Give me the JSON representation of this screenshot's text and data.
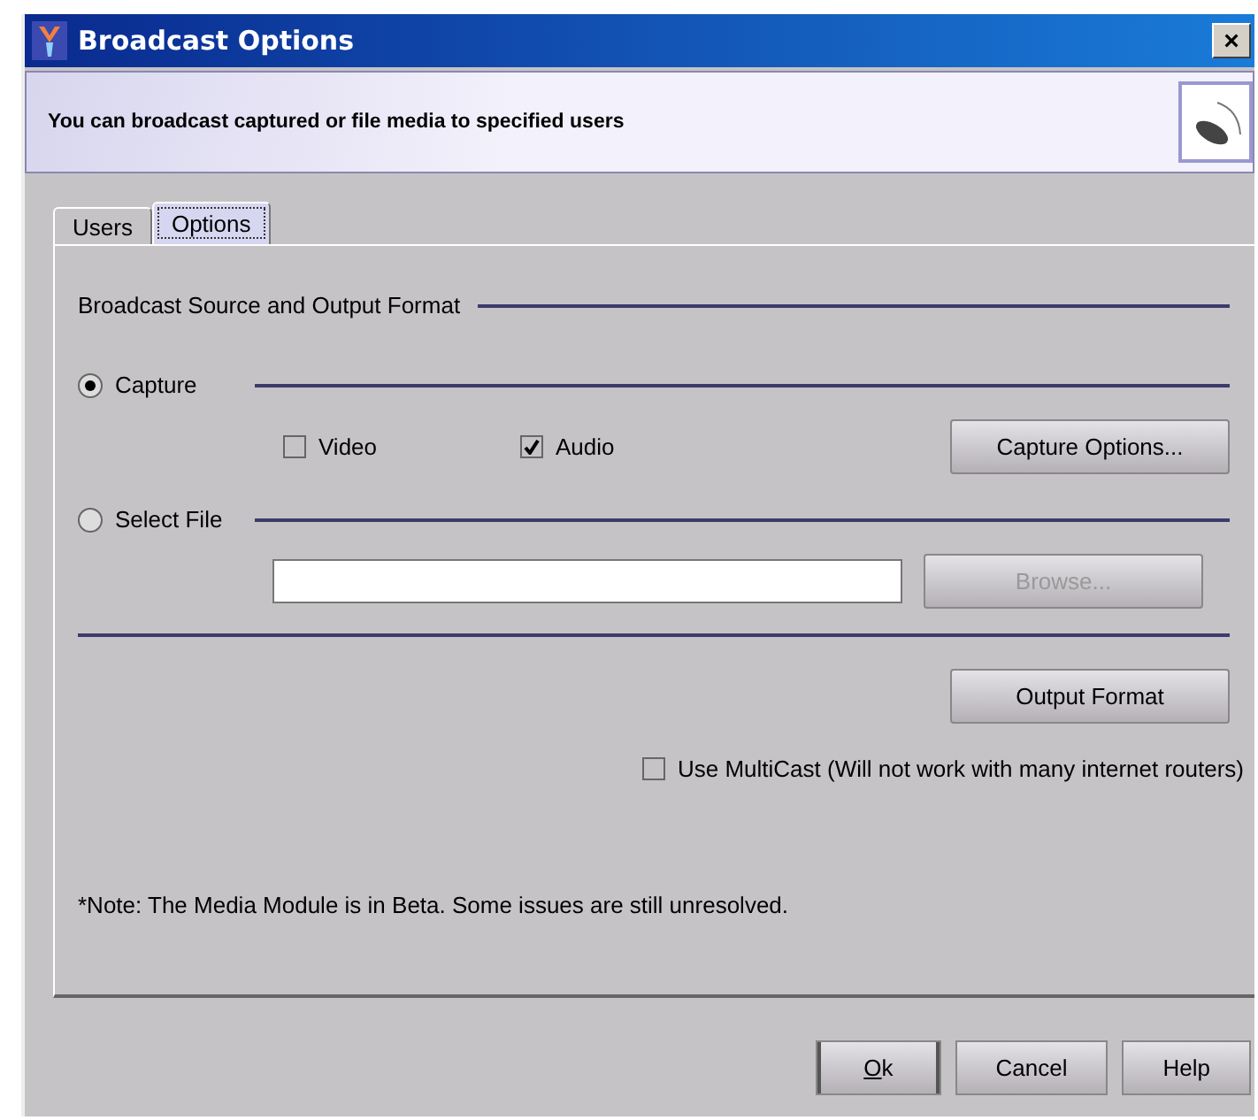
{
  "window": {
    "title": "Broadcast Options",
    "close": "×"
  },
  "banner": {
    "text": "You can broadcast captured or file media to specified users"
  },
  "tabs": [
    {
      "label": "Users",
      "selected": false
    },
    {
      "label": "Options",
      "selected": true
    }
  ],
  "section_title": "Broadcast Source and Output Format",
  "sources": [
    {
      "label": "Capture",
      "selected": true
    },
    {
      "label": "Select File",
      "selected": false
    }
  ],
  "capture": {
    "checks": [
      {
        "label": "Video",
        "checked": false
      },
      {
        "label": "Audio",
        "checked": true
      }
    ],
    "button": "Capture Options..."
  },
  "file": {
    "browse": {
      "label": "Browse...",
      "disabled": true
    }
  },
  "output_button": "Output Format",
  "multicast": {
    "label": "Use MultiCast (Will not work with many internet routers)",
    "checked": false
  },
  "note": "*Note: The Media Module is in Beta. Some issues are still unresolved.",
  "buttons": [
    {
      "label": "Ok",
      "default": true
    },
    {
      "label": "Cancel",
      "default": false
    },
    {
      "label": "Help",
      "default": false
    }
  ]
}
